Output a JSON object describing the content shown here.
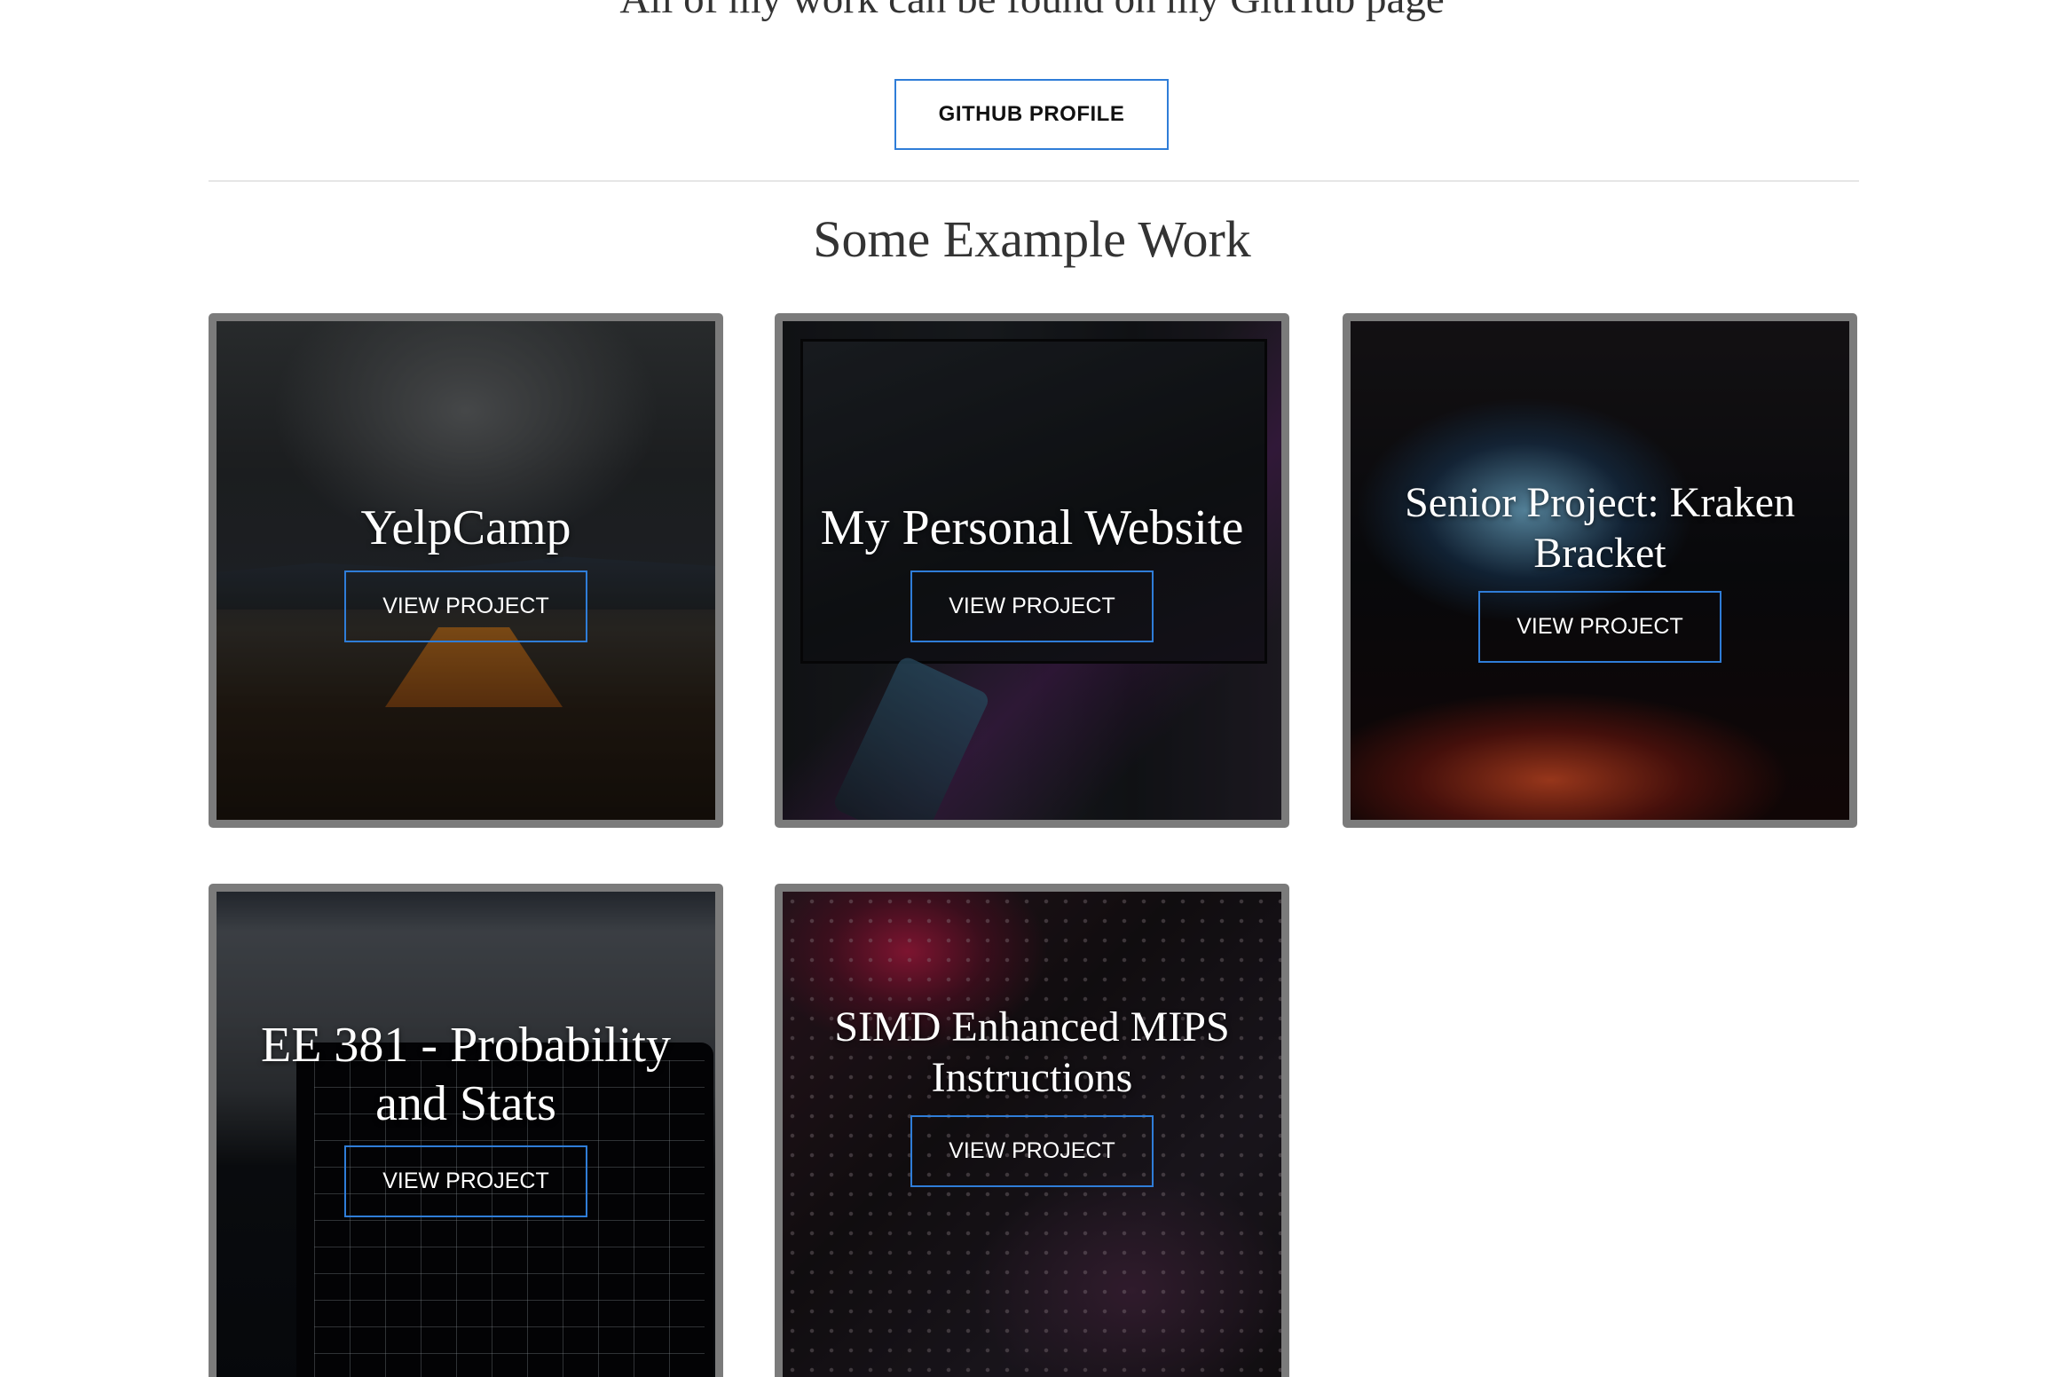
{
  "intro": {
    "text": "All of my work can be found on my GitHub page"
  },
  "github_button": {
    "label": "GITHUB PROFILE"
  },
  "section": {
    "title": "Some Example Work"
  },
  "projects": [
    {
      "title": "YelpCamp",
      "button": "VIEW PROJECT",
      "image": "camping-tent-under-clouds"
    },
    {
      "title": "My Personal Website",
      "button": "VIEW PROJECT",
      "image": "computer-monitor-and-phone"
    },
    {
      "title": "Senior Project: Kraken Bracket",
      "button": "VIEW PROJECT",
      "image": "person-at-glowing-monitor"
    },
    {
      "title": "EE 381 - Probability and Stats",
      "button": "VIEW PROJECT",
      "image": "laptop-with-stock-chart"
    },
    {
      "title": "SIMD Enhanced MIPS Instructions",
      "button": "VIEW PROJECT",
      "image": "circuit-board-closeup"
    }
  ],
  "colors": {
    "accent": "#2f7dd8",
    "card_border": "#7b7b7b",
    "heading_text": "#333333"
  }
}
